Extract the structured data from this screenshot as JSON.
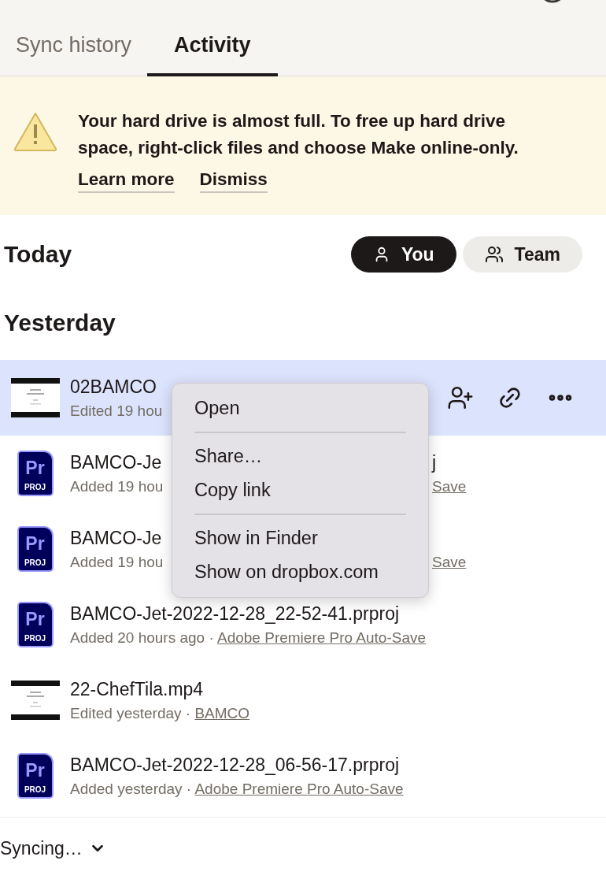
{
  "tabs": [
    {
      "label": "Sync history",
      "selected": false
    },
    {
      "label": "Activity",
      "selected": true
    }
  ],
  "banner": {
    "message": "Your hard drive is almost full. To free up hard drive space, right-click files and choose Make online-only.",
    "actions": [
      "Learn more",
      "Dismiss"
    ]
  },
  "today": {
    "title": "Today",
    "filters": [
      {
        "label": "You",
        "kind": "person",
        "selected": true
      },
      {
        "label": "Team",
        "kind": "team",
        "selected": false
      }
    ]
  },
  "yesterday": {
    "title": "Yesterday"
  },
  "rows": [
    {
      "selected": true,
      "icon": {
        "kind": "video"
      },
      "name": "02BAMCO",
      "meta": "Edited 19 hou"
    },
    {
      "selected": false,
      "icon": {
        "kind": "premiere",
        "label": "Pr",
        "sublabel": "PROJ"
      },
      "name": "BAMCO-Je",
      "name_tail": "j",
      "meta": "Added 19 hou",
      "folder_tail": "Save"
    },
    {
      "selected": false,
      "icon": {
        "kind": "premiere",
        "label": "Pr",
        "sublabel": "PROJ"
      },
      "name": "BAMCO-Je",
      "meta": "Added 19 hou",
      "folder_tail": "Save"
    },
    {
      "selected": false,
      "icon": {
        "kind": "premiere",
        "label": "Pr",
        "sublabel": "PROJ"
      },
      "name": "BAMCO-Jet-2022-12-28_22-52-41.prproj",
      "meta": "Added 20 hours ago · ",
      "folder": "Adobe Premiere Pro Auto-Save"
    },
    {
      "selected": false,
      "icon": {
        "kind": "video"
      },
      "name": "22-ChefTila.mp4",
      "meta": "Edited yesterday · ",
      "folder": "BAMCO"
    },
    {
      "selected": false,
      "icon": {
        "kind": "premiere",
        "label": "Pr",
        "sublabel": "PROJ"
      },
      "name": "BAMCO-Jet-2022-12-28_06-56-17.prproj",
      "meta": "Added yesterday · ",
      "folder": "Adobe Premiere Pro Auto-Save"
    }
  ],
  "context_menu": {
    "groups": [
      [
        "Open"
      ],
      [
        "Share…",
        "Copy link"
      ],
      [
        "Show in Finder",
        "Show on dropbox.com"
      ]
    ]
  },
  "status_bar": {
    "label": "Syncing…"
  }
}
